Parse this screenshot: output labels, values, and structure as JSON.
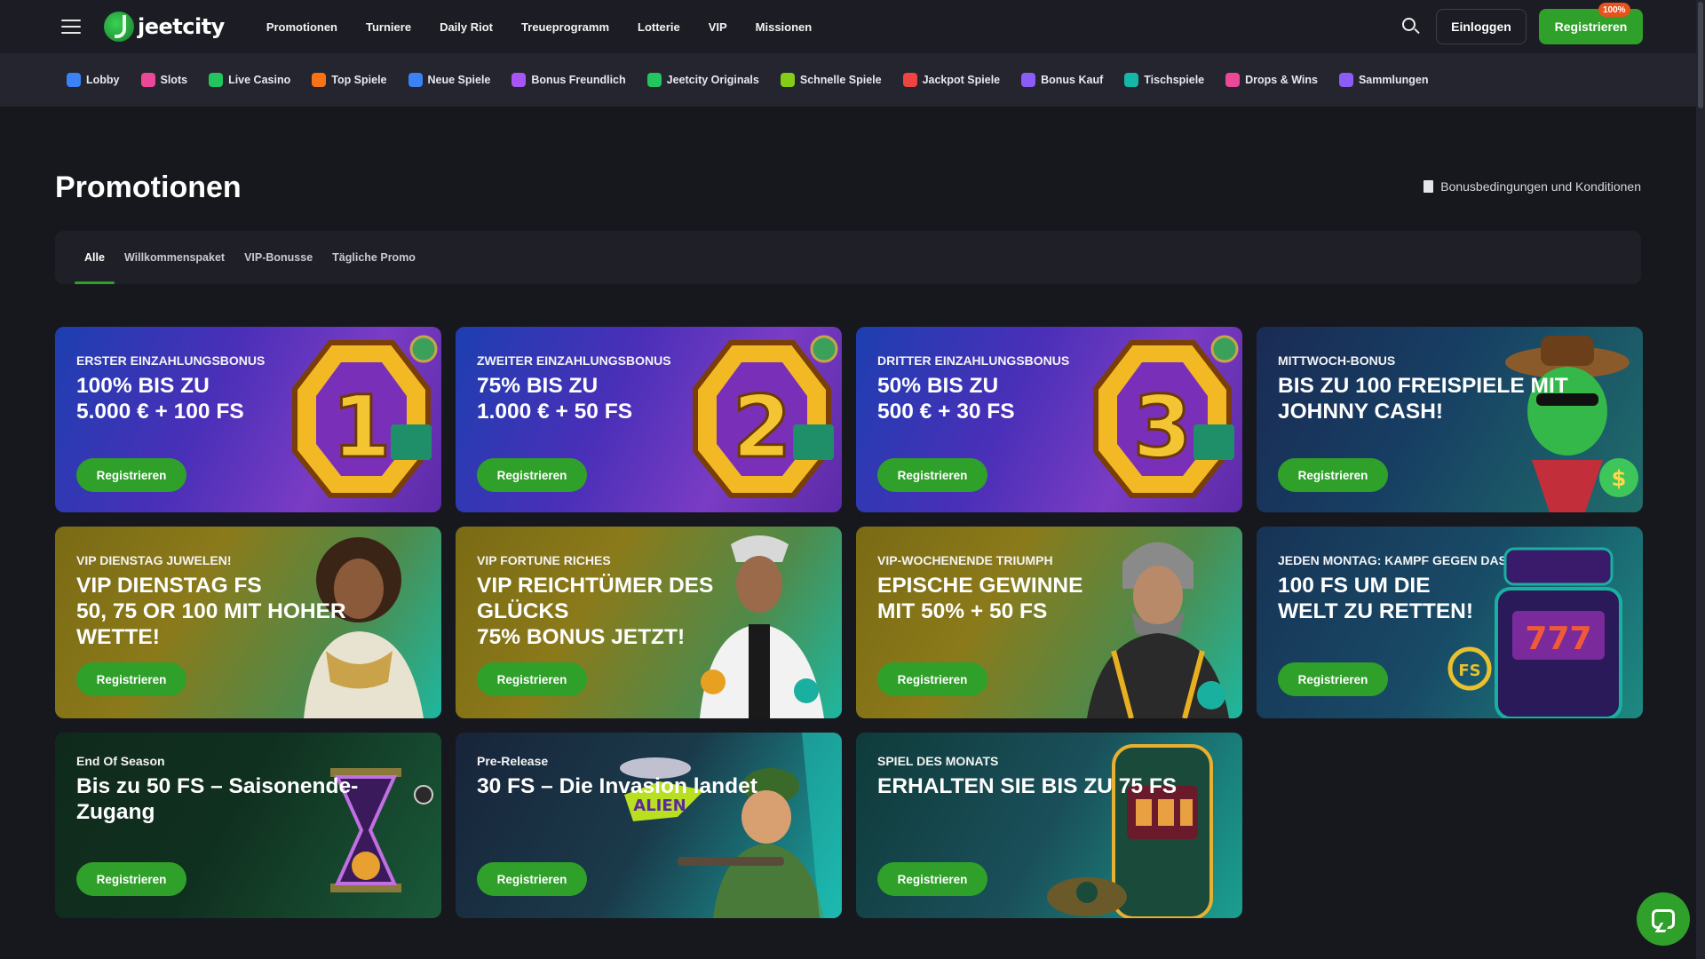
{
  "header": {
    "logo_text": "jeetcity",
    "nav": [
      "Promotionen",
      "Turniere",
      "Daily Riot",
      "Treueprogramm",
      "Lotterie",
      "VIP",
      "Missionen"
    ],
    "login_label": "Einloggen",
    "register_label": "Registrieren",
    "register_badge": "100%"
  },
  "categories": [
    {
      "label": "Lobby",
      "icon": "home-icon",
      "color": "#3b82f6"
    },
    {
      "label": "Slots",
      "icon": "cherries-icon",
      "color": "#ec4899"
    },
    {
      "label": "Live Casino",
      "icon": "live-icon",
      "color": "#22c55e"
    },
    {
      "label": "Top Spiele",
      "icon": "fire-icon",
      "color": "#f97316"
    },
    {
      "label": "Neue Spiele",
      "icon": "calendar-icon",
      "color": "#3b82f6"
    },
    {
      "label": "Bonus Freundlich",
      "icon": "gift-icon",
      "color": "#a855f7"
    },
    {
      "label": "Jeetcity Originals",
      "icon": "jeetcity-icon",
      "color": "#22c55e"
    },
    {
      "label": "Schnelle Spiele",
      "icon": "lightning-icon",
      "color": "#84cc16"
    },
    {
      "label": "Jackpot Spiele",
      "icon": "jackpot-icon",
      "color": "#ef4444"
    },
    {
      "label": "Bonus Kauf",
      "icon": "shopping-icon",
      "color": "#8b5cf6"
    },
    {
      "label": "Tischspiele",
      "icon": "chip-icon",
      "color": "#14b8a6"
    },
    {
      "label": "Drops & Wins",
      "icon": "drop-icon",
      "color": "#ec4899"
    },
    {
      "label": "Sammlungen",
      "icon": "collection-icon",
      "color": "#8b5cf6"
    }
  ],
  "page": {
    "title": "Promotionen",
    "terms_link": "Bonusbedingungen und Konditionen",
    "tabs": [
      "Alle",
      "Willkommenspaket",
      "VIP-Bonusse",
      "Tägliche Promo"
    ],
    "active_tab": "Alle"
  },
  "promotions": [
    {
      "label": "ERSTER EINZAHLUNGSBONUS",
      "headline": "100% BIS ZU\n5.000 € + 100 FS",
      "cta": "Registrieren",
      "art": "number-1-icon"
    },
    {
      "label": "ZWEITER EINZAHLUNGSBONUS",
      "headline": "75% BIS ZU\n1.000 € + 50 FS",
      "cta": "Registrieren",
      "art": "number-2-icon"
    },
    {
      "label": "DRITTER EINZAHLUNGSBONUS",
      "headline": "50% BIS ZU\n500 € + 30 FS",
      "cta": "Registrieren",
      "art": "number-3-icon"
    },
    {
      "label": "MITTWOCH-BONUS",
      "headline": "BIS ZU 100 FREISPIELE MIT JOHNNY CASH!",
      "cta": "Registrieren",
      "art": "cowboy-icon"
    },
    {
      "label": "VIP DIENSTAG JUWELEN!",
      "headline": "VIP DIENSTAG FS\n50, 75 OR 100 MIT HOHER WETTE!",
      "cta": "Registrieren",
      "art": "woman-icon"
    },
    {
      "label": "VIP FORTUNE RICHES",
      "headline": "VIP REICHTÜMER DES GLÜCKS\n75% BONUS JETZT!",
      "cta": "Registrieren",
      "art": "man-icon"
    },
    {
      "label": "VIP-WOCHENENDE TRIUMPH",
      "headline": "EPISCHE GEWINNE\nMIT 50% + 50 FS",
      "cta": "Registrieren",
      "art": "warrior-icon"
    },
    {
      "label": "JEDEN MONTAG: KAMPF GEGEN DAS BÖSE",
      "headline": "100 FS UM DIE\nWELT ZU RETTEN!",
      "cta": "Registrieren",
      "art": "slot-machine-icon"
    },
    {
      "label": "End Of Season",
      "headline": "Bis zu 50 FS – Saisonende-Zugang",
      "cta": "Registrieren",
      "art": "hourglass-icon"
    },
    {
      "label": "Pre-Release",
      "headline": "30 FS – Die Invasion landet",
      "cta": "Registrieren",
      "art": "alien-xvasion-icon"
    },
    {
      "label": "SPIEL DES MONATS",
      "headline": "ERHALTEN SIE BIS ZU 75 FS",
      "cta": "Registrieren",
      "art": "slot-cake-icon"
    }
  ],
  "colors": {
    "accent": "#2fa02a",
    "background": "#17181d",
    "header": "#1c1d24",
    "catbar": "#24252e"
  }
}
